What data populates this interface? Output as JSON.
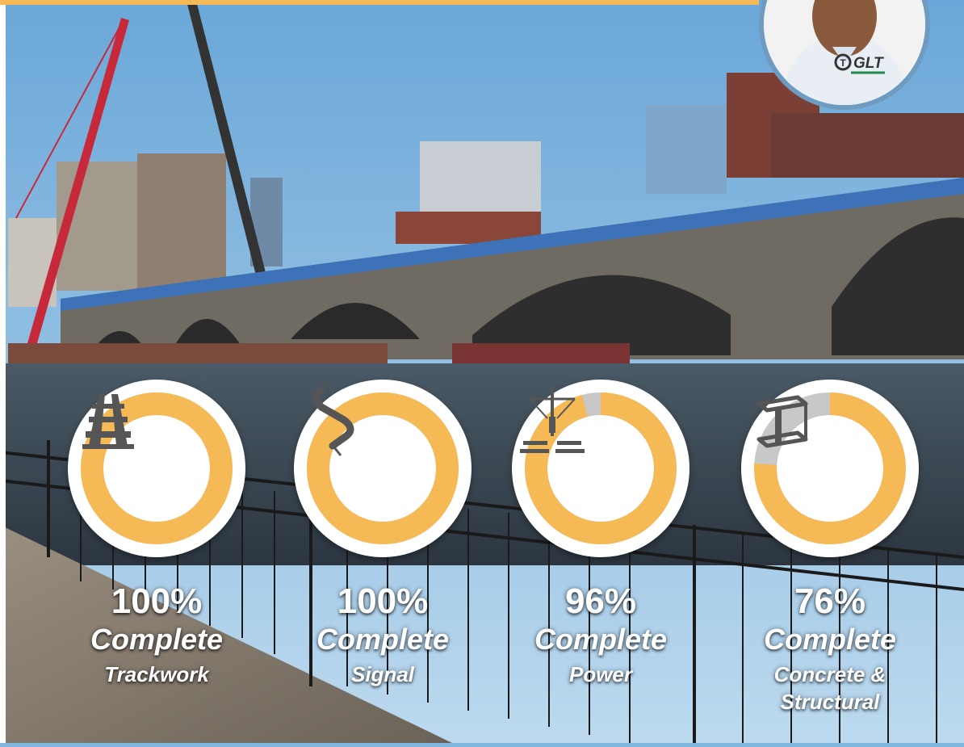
{
  "colors": {
    "accent": "#f5b955",
    "remaining": "#c8c8c8",
    "icon": "#555555",
    "ring_bg": "#ffffff"
  },
  "avatar": {
    "logo_text": "GLT",
    "logo_mark": "T"
  },
  "metrics": [
    {
      "percent_label": "100%",
      "percent": 100,
      "complete_label": "Complete",
      "category": "Trackwork",
      "icon": "railroad-track-icon"
    },
    {
      "percent_label": "100%",
      "percent": 100,
      "complete_label": "Complete",
      "category": "Signal",
      "icon": "cable-icon"
    },
    {
      "percent_label": "96%",
      "percent": 96,
      "complete_label": "Complete",
      "category": "Power",
      "icon": "power-pole-icon"
    },
    {
      "percent_label": "76%",
      "percent": 76,
      "complete_label": "Complete",
      "category": "Concrete &\nStructural",
      "icon": "steel-beam-icon"
    }
  ]
}
